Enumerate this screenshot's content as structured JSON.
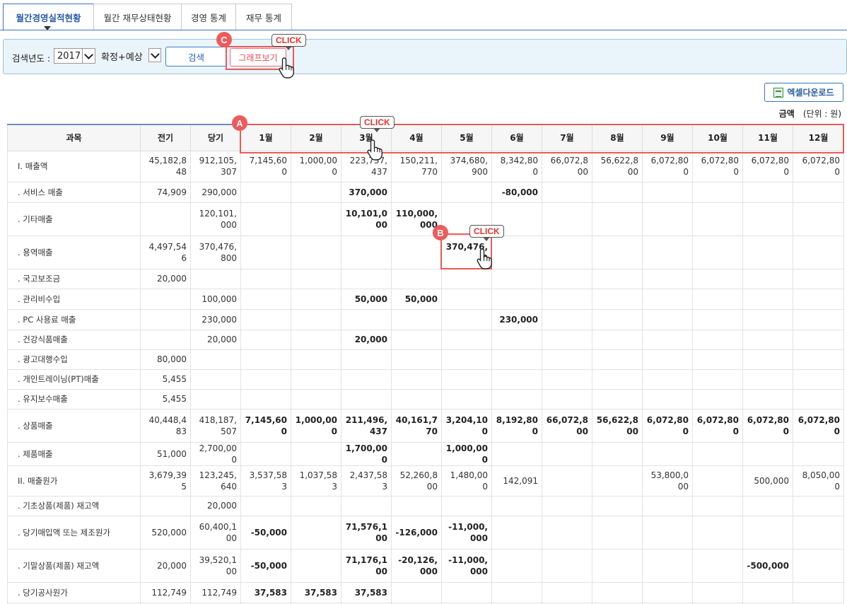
{
  "tabs": [
    {
      "label": "월간경영실적현황",
      "active": true
    },
    {
      "label": "월간 재무상태현황",
      "active": false
    },
    {
      "label": "경영 통계",
      "active": false
    },
    {
      "label": "재무 통계",
      "active": false
    }
  ],
  "search": {
    "year_label": "검색년도 :",
    "year_value": "2017",
    "mode_value": "확정+예상",
    "search_button": "검색",
    "graph_button": "그래프보기"
  },
  "annotations": {
    "a": "A",
    "b": "B",
    "c": "C",
    "click": "CLICK"
  },
  "toolbar": {
    "excel_button": "엑셀다운로드",
    "unit_label": "금액",
    "unit_value": "(단위 : 원)"
  },
  "table": {
    "headers": [
      "과목",
      "전기",
      "당기",
      "1월",
      "2월",
      "3월",
      "4월",
      "5월",
      "6월",
      "7월",
      "8월",
      "9월",
      "10월",
      "11월",
      "12월"
    ],
    "rows": [
      {
        "h": 44,
        "cells": [
          "I. 매출액",
          "45,182,848",
          "912,105,307",
          "7,145,600",
          "1,000,000",
          "223,737,437",
          "150,211,770",
          "374,680,900",
          "8,342,800",
          "66,072,800",
          "56,622,800",
          "6,072,800",
          "6,072,800",
          "6,072,800",
          "6,072,800"
        ],
        "bold": []
      },
      {
        "h": 29,
        "cells": [
          ". 서비스 매출",
          "74,909",
          "290,000",
          "",
          "",
          "370,000",
          "",
          "",
          "-80,000",
          "",
          "",
          "",
          "",
          "",
          ""
        ],
        "bold": [
          5,
          8
        ]
      },
      {
        "h": 47,
        "cells": [
          ". 기타매출",
          "",
          "120,101,000",
          "",
          "",
          "10,101,000",
          "110,000,000",
          "",
          "",
          "",
          "",
          "",
          "",
          "",
          ""
        ],
        "bold": [
          5,
          6
        ]
      },
      {
        "h": 47,
        "cells": [
          ". 용역매출",
          "4,497,546",
          "370,476,800",
          "",
          "",
          "",
          "",
          "370,476,8",
          "",
          "",
          "",
          "",
          "",
          "",
          ""
        ],
        "bold": [
          7
        ]
      },
      {
        "h": 28,
        "cells": [
          ". 국고보조금",
          "20,000",
          "",
          "",
          "",
          "",
          "",
          "",
          "",
          "",
          "",
          "",
          "",
          "",
          ""
        ],
        "bold": []
      },
      {
        "h": 29,
        "cells": [
          ". 관리비수입",
          "",
          "100,000",
          "",
          "",
          "50,000",
          "50,000",
          "",
          "",
          "",
          "",
          "",
          "",
          "",
          ""
        ],
        "bold": [
          5,
          6
        ]
      },
      {
        "h": 29,
        "cells": [
          ". PC 사용료 매출",
          "",
          "230,000",
          "",
          "",
          "",
          "",
          "",
          "230,000",
          "",
          "",
          "",
          "",
          "",
          ""
        ],
        "bold": [
          8
        ]
      },
      {
        "h": 28,
        "cells": [
          ". 건강식품매출",
          "",
          "20,000",
          "",
          "",
          "20,000",
          "",
          "",
          "",
          "",
          "",
          "",
          "",
          "",
          ""
        ],
        "bold": [
          5
        ]
      },
      {
        "h": 28,
        "cells": [
          ". 광고대행수입",
          "80,000",
          "",
          "",
          "",
          "",
          "",
          "",
          "",
          "",
          "",
          "",
          "",
          "",
          ""
        ],
        "bold": []
      },
      {
        "h": 28,
        "cells": [
          ". 개인트레이닝(PT)매출",
          "5,455",
          "",
          "",
          "",
          "",
          "",
          "",
          "",
          "",
          "",
          "",
          "",
          "",
          ""
        ],
        "bold": []
      },
      {
        "h": 28,
        "cells": [
          ". 유지보수매출",
          "5,455",
          "",
          "",
          "",
          "",
          "",
          "",
          "",
          "",
          "",
          "",
          "",
          "",
          ""
        ],
        "bold": []
      },
      {
        "h": 47,
        "cells": [
          ". 상품매출",
          "40,448,483",
          "418,187,507",
          "7,145,600",
          "1,000,000",
          "211,496,437",
          "40,161,770",
          "3,204,100",
          "8,192,800",
          "66,072,800",
          "56,622,800",
          "6,072,800",
          "6,072,800",
          "6,072,800",
          "6,072,800"
        ],
        "bold": [
          3,
          4,
          5,
          6,
          7,
          8,
          9,
          10,
          11,
          12,
          13,
          14
        ]
      },
      {
        "h": 29,
        "cells": [
          ". 제품매출",
          "51,000",
          "2,700,000",
          "",
          "",
          "1,700,000",
          "",
          "1,000,000",
          "",
          "",
          "",
          "",
          "",
          "",
          ""
        ],
        "bold": [
          5,
          7
        ]
      },
      {
        "h": 43,
        "cells": [
          "II. 매출원가",
          "3,679,395",
          "123,245,640",
          "3,537,583",
          "1,037,583",
          "2,437,583",
          "52,260,800",
          "1,480,000",
          "142,091",
          "",
          "",
          "53,800,000",
          "",
          "500,000",
          "8,050,000"
        ],
        "bold": []
      },
      {
        "h": 28,
        "cells": [
          ". 기초상품(제품) 재고액",
          "",
          "20,000",
          "",
          "",
          "",
          "",
          "",
          "",
          "",
          "",
          "",
          "",
          "",
          ""
        ],
        "bold": []
      },
      {
        "h": 47,
        "cells": [
          ". 당기매입액 또는 제조원가",
          "520,000",
          "60,400,100",
          "-50,000",
          "",
          "71,576,100",
          "-126,000",
          "-11,000,000",
          "",
          "",
          "",
          "",
          "",
          "",
          ""
        ],
        "bold": [
          3,
          5,
          6,
          7
        ]
      },
      {
        "h": 47,
        "cells": [
          ". 기말상품(제품) 재고액",
          "20,000",
          "39,520,100",
          "-50,000",
          "",
          "71,176,100",
          "-20,126,000",
          "-11,000,000",
          "",
          "",
          "",
          "",
          "",
          "-500,000",
          ""
        ],
        "bold": [
          3,
          5,
          6,
          7,
          13
        ]
      },
      {
        "h": 29,
        "cells": [
          ". 당기공사원가",
          "112,749",
          "112,749",
          "37,583",
          "37,583",
          "37,583",
          "",
          "",
          "",
          "",
          "",
          "",
          "",
          "",
          ""
        ],
        "bold": [
          3,
          4,
          5
        ]
      },
      {
        "h": 20,
        "cells": [
          "",
          "",
          "",
          "",
          "",
          "",
          "",
          "",
          "",
          "",
          "",
          "",
          "",
          "",
          ""
        ],
        "bold": []
      }
    ]
  }
}
